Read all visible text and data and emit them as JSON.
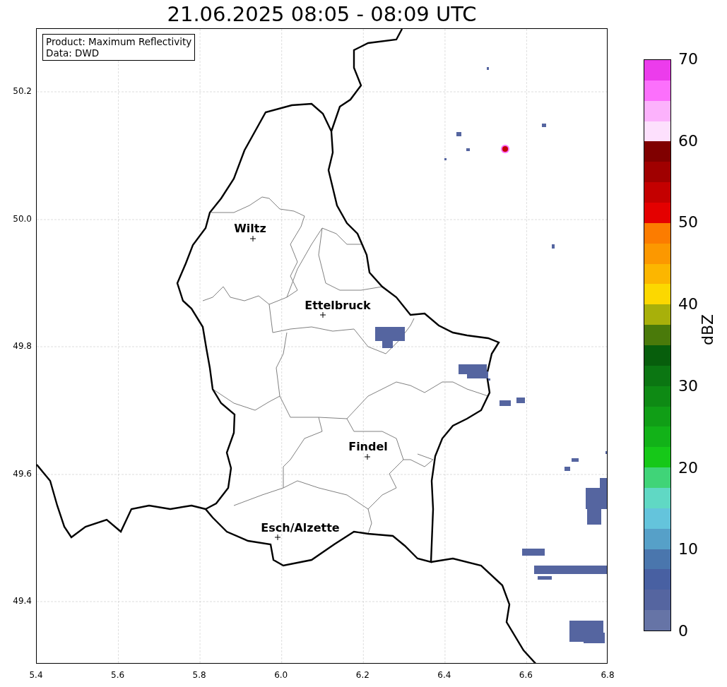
{
  "title": "21.06.2025 08:05 - 08:09 UTC",
  "info_box": [
    "Product: Maximum Reflectivity",
    "Data: DWD"
  ],
  "map": {
    "x_ticks": [
      "5.4",
      "5.6",
      "5.8",
      "6.0",
      "6.2",
      "6.4",
      "6.6",
      "6.8"
    ],
    "y_ticks": [
      "50.2",
      "50.0",
      "49.8",
      "49.6",
      "49.4"
    ],
    "cities": [
      "Wiltz",
      "Ettelbruck",
      "Findel",
      "Esch/Alzette"
    ]
  },
  "colorbar": {
    "label": "dBZ",
    "ticks": [
      "70",
      "60",
      "50",
      "40",
      "30",
      "20",
      "10",
      "0"
    ],
    "bins": [
      {
        "color": "#ec3cec"
      },
      {
        "color": "#fc70fc"
      },
      {
        "color": "#fcb2fc"
      },
      {
        "color": "#fde0fd"
      },
      {
        "color": "#800000"
      },
      {
        "color": "#a00000"
      },
      {
        "color": "#c40000"
      },
      {
        "color": "#e40000"
      },
      {
        "color": "#fc7c00"
      },
      {
        "color": "#fc9800"
      },
      {
        "color": "#fcb600"
      },
      {
        "color": "#fcd800"
      },
      {
        "color": "#a8b00a"
      },
      {
        "color": "#4a7a0a"
      },
      {
        "color": "#075e0c"
      },
      {
        "color": "#0b7612"
      },
      {
        "color": "#0e8a14"
      },
      {
        "color": "#109e16"
      },
      {
        "color": "#12b218"
      },
      {
        "color": "#16c818"
      },
      {
        "color": "#40d478"
      },
      {
        "color": "#60d8c4"
      },
      {
        "color": "#64c4dc"
      },
      {
        "color": "#56a0c8"
      },
      {
        "color": "#4a76ad"
      },
      {
        "color": "#4860a2"
      },
      {
        "color": "#5565a0"
      },
      {
        "color": "#6674a6"
      }
    ]
  }
}
